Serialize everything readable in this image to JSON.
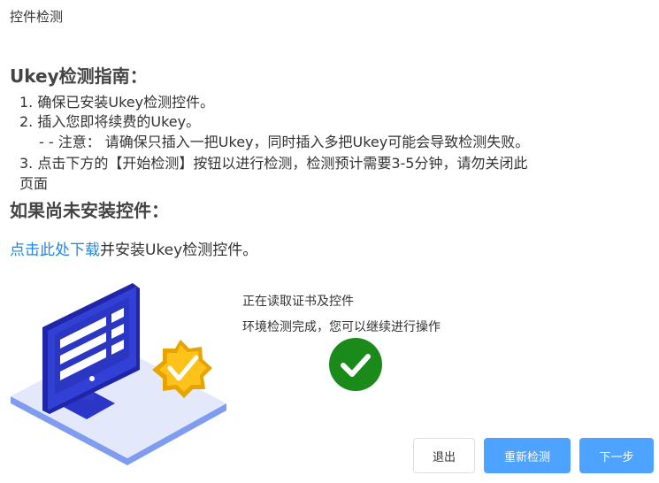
{
  "window": {
    "title": "控件检测"
  },
  "guide": {
    "heading": "Ukey检测指南：",
    "steps": [
      "1. 确保已安装Ukey检测控件。",
      "2. 插入您即将续费的Ukey。",
      "- - 注意： 请确保只插入一把Ukey，同时插入多把Ukey可能会导致检测失败。",
      "3. 点击下方的【开始检测】按钮以进行检测，检测预计需要3-5分钟，请勿关闭此",
      "页面"
    ]
  },
  "install": {
    "heading": "如果尚未安装控件：",
    "link_text": "点击此处下载",
    "rest_text": "并安装Ukey检测控件。"
  },
  "status": {
    "line1": "正在读取证书及控件",
    "line2": "环境检测完成，您可以继续进行操作",
    "icon": "check-circle-icon",
    "color": "#1a8a1a"
  },
  "buttons": {
    "exit": "退出",
    "retest": "重新检测",
    "next": "下一步"
  },
  "colors": {
    "primary": "#4da3ff",
    "link": "#1e88e5",
    "success": "#1a8a1a"
  }
}
